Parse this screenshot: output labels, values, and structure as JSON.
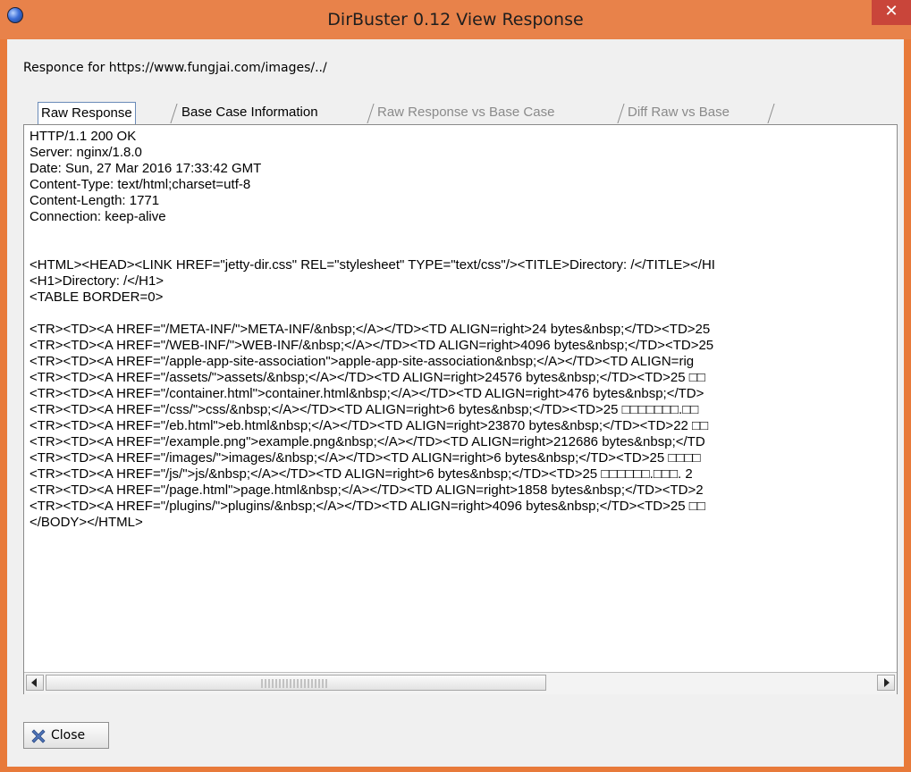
{
  "window": {
    "title": "DirBuster 0.12 View Response",
    "close_glyph": "✕"
  },
  "header": {
    "url_label": "Responce for https://www.fungjai.com/images/../"
  },
  "tabs": [
    {
      "label": "Raw Response",
      "state": "active"
    },
    {
      "label": "Base Case Information",
      "state": "normal"
    },
    {
      "label": "Raw Response vs Base Case",
      "state": "disabled"
    },
    {
      "label": "Diff Raw vs Base",
      "state": "disabled"
    }
  ],
  "raw_response": {
    "lines": [
      "HTTP/1.1 200 OK",
      "Server: nginx/1.8.0",
      "Date: Sun, 27 Mar 2016 17:33:42 GMT",
      "Content-Type: text/html;charset=utf-8",
      "Content-Length: 1771",
      "Connection: keep-alive",
      "",
      "",
      "<HTML><HEAD><LINK HREF=\"jetty-dir.css\" REL=\"stylesheet\" TYPE=\"text/css\"/><TITLE>Directory: /</TITLE></HI",
      "<H1>Directory: /</H1>",
      "<TABLE BORDER=0>",
      "",
      "<TR><TD><A HREF=\"/META-INF/\">META-INF/&nbsp;</A></TD><TD ALIGN=right>24 bytes&nbsp;</TD><TD>25",
      "<TR><TD><A HREF=\"/WEB-INF/\">WEB-INF/&nbsp;</A></TD><TD ALIGN=right>4096 bytes&nbsp;</TD><TD>25",
      "<TR><TD><A HREF=\"/apple-app-site-association\">apple-app-site-association&nbsp;</A></TD><TD ALIGN=rig",
      "<TR><TD><A HREF=\"/assets/\">assets/&nbsp;</A></TD><TD ALIGN=right>24576 bytes&nbsp;</TD><TD>25 □□",
      "<TR><TD><A HREF=\"/container.html\">container.html&nbsp;</A></TD><TD ALIGN=right>476 bytes&nbsp;</TD>",
      "<TR><TD><A HREF=\"/css/\">css/&nbsp;</A></TD><TD ALIGN=right>6 bytes&nbsp;</TD><TD>25 □□□□□□□.□□",
      "<TR><TD><A HREF=\"/eb.html\">eb.html&nbsp;</A></TD><TD ALIGN=right>23870 bytes&nbsp;</TD><TD>22 □□",
      "<TR><TD><A HREF=\"/example.png\">example.png&nbsp;</A></TD><TD ALIGN=right>212686 bytes&nbsp;</TD",
      "<TR><TD><A HREF=\"/images/\">images/&nbsp;</A></TD><TD ALIGN=right>6 bytes&nbsp;</TD><TD>25 □□□□",
      "<TR><TD><A HREF=\"/js/\">js/&nbsp;</A></TD><TD ALIGN=right>6 bytes&nbsp;</TD><TD>25 □□□□□□.□□□. 2",
      "<TR><TD><A HREF=\"/page.html\">page.html&nbsp;</A></TD><TD ALIGN=right>1858 bytes&nbsp;</TD><TD>2",
      "<TR><TD><A HREF=\"/plugins/\">plugins/&nbsp;</A></TD><TD ALIGN=right>4096 bytes&nbsp;</TD><TD>25 □□",
      "</BODY></HTML>"
    ]
  },
  "footer": {
    "close_label": "Close"
  },
  "colors": {
    "titlebar": "#e8824a",
    "close_button_bg": "#c9453a",
    "active_tab_border": "#6a8bb8",
    "disabled_text": "#8a8a8a"
  }
}
